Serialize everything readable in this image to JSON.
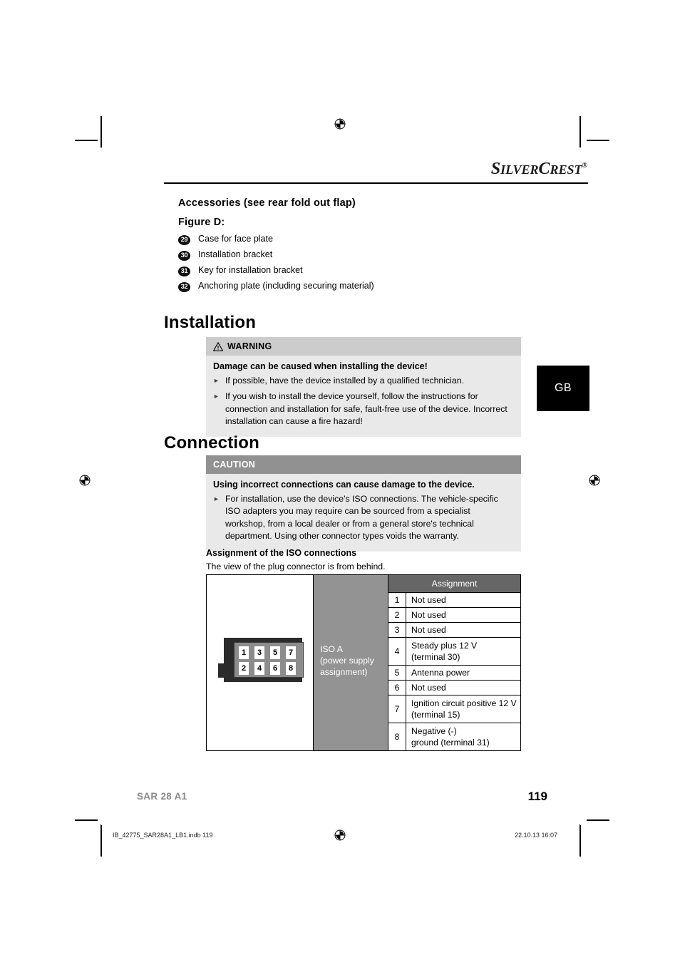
{
  "brand": {
    "name_part1": "S",
    "name_part2": "ILVER",
    "name_part3": "C",
    "name_part4": "REST",
    "trademark": "®"
  },
  "language_tab": {
    "label": "GB"
  },
  "accessories": {
    "heading": "Accessories (see rear fold out flap)",
    "figure_label": "Figure D:",
    "items": [
      {
        "number": "29",
        "label": "Case for face plate"
      },
      {
        "number": "30",
        "label": "Installation bracket"
      },
      {
        "number": "31",
        "label": "Key for installation bracket"
      },
      {
        "number": "32",
        "label": "Anchoring plate (including securing material)"
      }
    ]
  },
  "installation": {
    "heading": "Installation",
    "warning": {
      "header": "WARNING",
      "icon": "warning-triangle-icon",
      "title": "Damage can be caused when installing the device!",
      "bullets": [
        "If possible, have the device installed by a qualified technician.",
        "If you wish to install the device yourself, follow the instructions for connection and installation for safe, fault-free use of the device. Incorrect installation can cause a fire hazard!"
      ]
    }
  },
  "connection": {
    "heading": "Connection",
    "caution": {
      "header": "CAUTION",
      "title": "Using incorrect connections can cause damage to the device.",
      "bullets": [
        "For installation, use the device's ISO connections. The vehicle-specific ISO adapters you may require can be sourced from a specialist workshop, from a local dealer or from a general store's technical department. Using other connector types voids the warranty."
      ]
    },
    "assignment_heading": "Assignment of the ISO connections",
    "assignment_note": "The view of the plug connector is from behind."
  },
  "iso_table": {
    "connector_label": "ISO A\n(power supply\nassignment)",
    "connector_label_line1": "ISO A",
    "connector_label_line2": "(power supply",
    "connector_label_line3": "assignment)",
    "column_header": "Assignment",
    "connector_pins": [
      "1",
      "3",
      "5",
      "7",
      "2",
      "4",
      "6",
      "8"
    ],
    "rows": [
      {
        "pin": "1",
        "line1": "Not used",
        "line2": ""
      },
      {
        "pin": "2",
        "line1": "Not used",
        "line2": ""
      },
      {
        "pin": "3",
        "line1": "Not used",
        "line2": ""
      },
      {
        "pin": "4",
        "line1": "Steady plus 12 V",
        "line2": "(terminal 30)"
      },
      {
        "pin": "5",
        "line1": "Antenna power",
        "line2": ""
      },
      {
        "pin": "6",
        "line1": "Not used",
        "line2": ""
      },
      {
        "pin": "7",
        "line1": "Ignition circuit positive 12 V",
        "line2": "(terminal 15)"
      },
      {
        "pin": "8",
        "line1": "Negative (-)",
        "line2": "ground (terminal 31)"
      }
    ]
  },
  "footer": {
    "model": "SAR 28 A1",
    "page_number": "119",
    "print_file": "IB_42775_SAR28A1_LB1.indb   119",
    "print_timestamp": "22.10.13   16:07"
  },
  "colors": {
    "warning_header_bg": "#cccccc",
    "caution_header_bg": "#919191",
    "notice_body_bg": "#e9e9e9",
    "table_label_bg": "#939393",
    "table_header_bg": "#666666",
    "footer_model": "#8a8a8a"
  }
}
